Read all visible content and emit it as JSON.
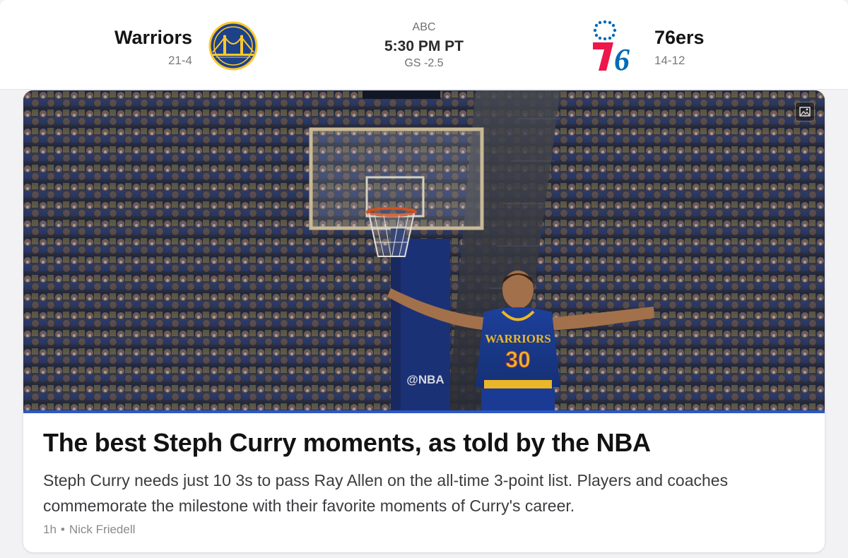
{
  "game": {
    "home": {
      "name": "Warriors",
      "record": "21-4",
      "logo_icon": "warriors-logo-icon",
      "color": "#1d428a",
      "accent": "#ffc72c"
    },
    "away": {
      "name": "76ers",
      "record": "14-12",
      "logo_icon": "sixers-logo-icon",
      "color": "#006bb6",
      "accent": "#ed174c"
    },
    "network": "ABC",
    "time": "5:30 PM PT",
    "line": "GS -2.5"
  },
  "article": {
    "headline": "The best Steph Curry moments, as told by the NBA",
    "summary": "Steph Curry needs just 10 3s to pass Ray Allen on the all-time 3-point list. Players and coaches commemorate the milestone with their favorite moments of Curry's career.",
    "age": "1h",
    "separator": "•",
    "author": "Nick Friedell",
    "image_badge_icon": "image-gallery-icon",
    "photo": {
      "jersey_name": "WARRIORS",
      "jersey_number": "30",
      "stanchion_text": "@NBA",
      "accent": "#2c58c7"
    }
  }
}
